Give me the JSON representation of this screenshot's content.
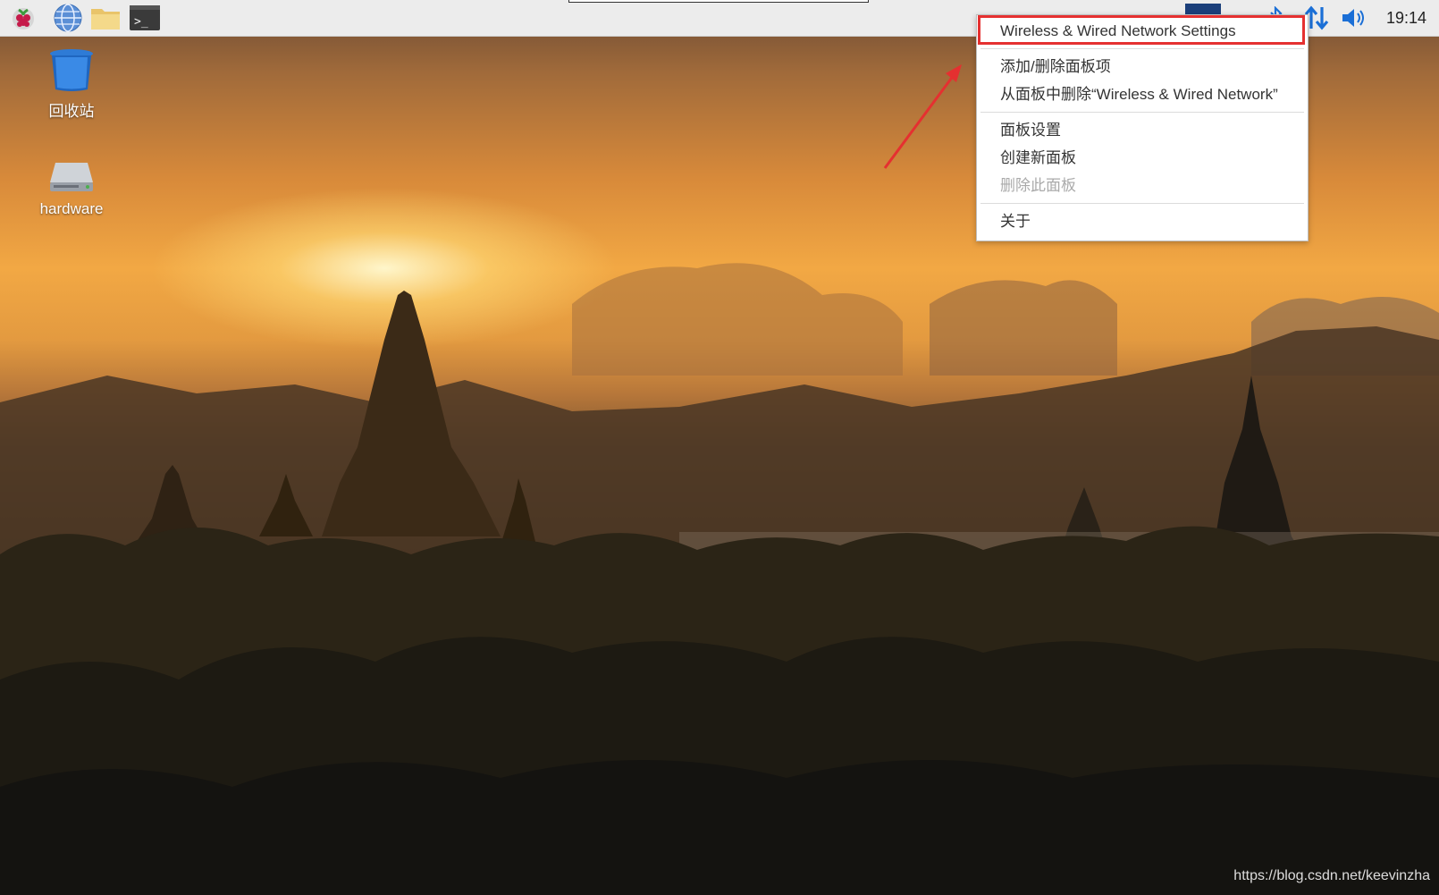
{
  "panel": {
    "launchers": [
      {
        "name": "raspberry-menu-icon"
      },
      {
        "name": "web-browser-icon"
      },
      {
        "name": "file-manager-icon"
      },
      {
        "name": "terminal-icon"
      }
    ],
    "tray": {
      "vnc_icon": "vnc-icon",
      "bluetooth_icon": "bluetooth-icon",
      "network_icon": "network-updown-icon",
      "volume_icon": "volume-icon"
    },
    "clock": "19:14",
    "accent": "#1b6fd6"
  },
  "desktop": {
    "icons": [
      {
        "label": "回收站",
        "icon": "trash-icon"
      },
      {
        "label": "hardware",
        "icon": "drive-icon"
      }
    ]
  },
  "context_menu": {
    "items": [
      {
        "label": "Wireless & Wired Network Settings",
        "enabled": true,
        "highlighted": true
      },
      {
        "label": "添加/删除面板项",
        "enabled": true
      },
      {
        "label": "从面板中删除“Wireless & Wired Network”",
        "enabled": true
      },
      {
        "label": "面板设置",
        "enabled": true
      },
      {
        "label": "创建新面板",
        "enabled": true
      },
      {
        "label": "删除此面板",
        "enabled": false
      },
      {
        "label": "关于",
        "enabled": true
      }
    ],
    "highlight_color": "#e53030"
  },
  "watermark": "https://blog.csdn.net/keevinzha"
}
